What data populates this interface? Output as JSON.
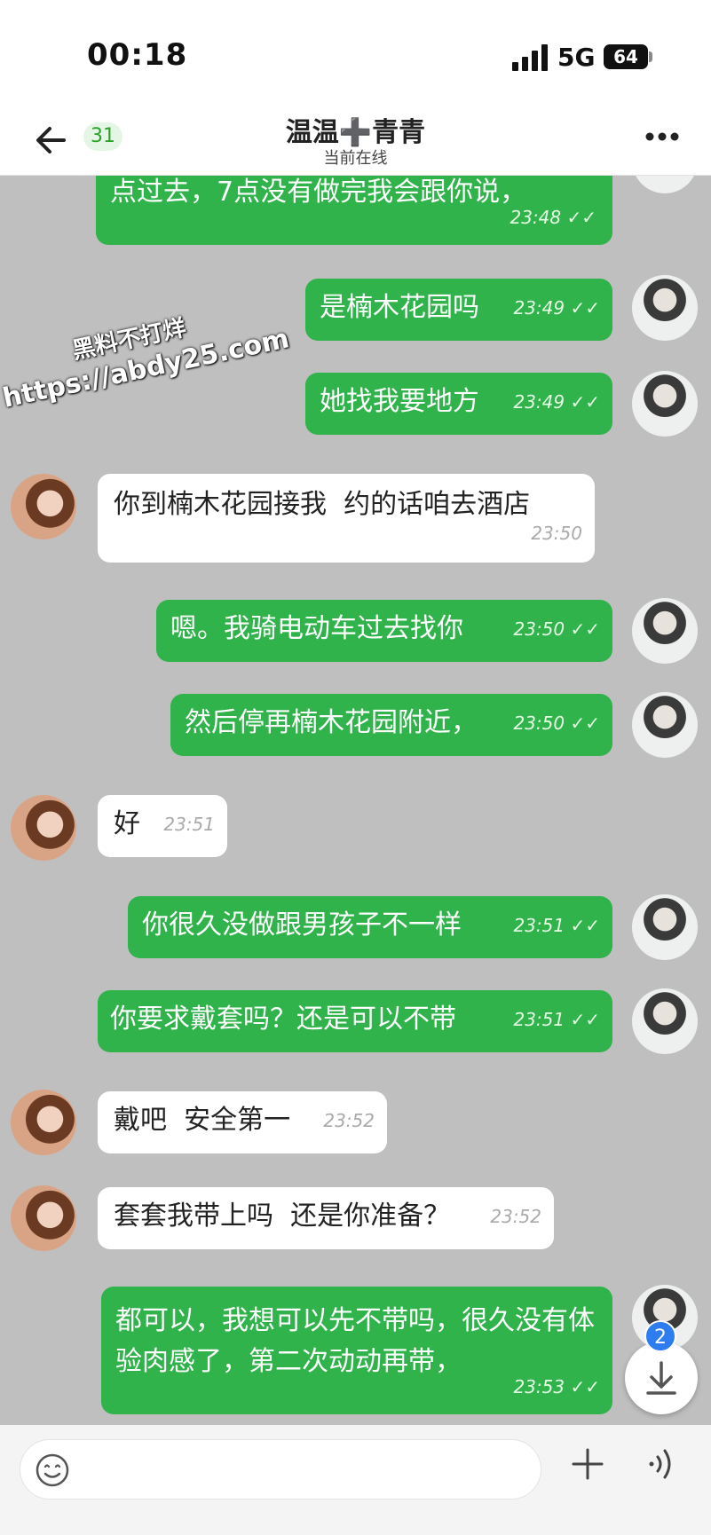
{
  "status": {
    "time": "00:18",
    "network": "5G",
    "battery": "64"
  },
  "header": {
    "unread": "31",
    "title": "温温➕青青",
    "subtitle": "当前在线",
    "icons": {
      "back": "arrow-left-icon",
      "more": "more-dots-icon"
    }
  },
  "watermark": {
    "line1": "黑料不打烊",
    "line2": "https://abdy25.com"
  },
  "messages": [
    {
      "dir": "out",
      "text": "点过去，7点没有做完我会跟你说，",
      "time": "23:48"
    },
    {
      "dir": "out",
      "text": "是楠木花园吗",
      "time": "23:49"
    },
    {
      "dir": "out",
      "text": "她找我要地方",
      "time": "23:49"
    },
    {
      "dir": "in",
      "text": "你到楠木花园接我  约的话咱去酒店",
      "time": "23:50"
    },
    {
      "dir": "out",
      "text": "嗯。我骑电动车过去找你",
      "time": "23:50"
    },
    {
      "dir": "out",
      "text": "然后停再楠木花园附近，",
      "time": "23:50"
    },
    {
      "dir": "in",
      "text": "好",
      "time": "23:51"
    },
    {
      "dir": "out",
      "text": "你很久没做跟男孩子不一样",
      "time": "23:51"
    },
    {
      "dir": "out",
      "text": "你要求戴套吗？还是可以不带",
      "time": "23:51"
    },
    {
      "dir": "in",
      "text": "戴吧  安全第一",
      "time": "23:52"
    },
    {
      "dir": "in",
      "text": "套套我带上吗  还是你准备？",
      "time": "23:52"
    },
    {
      "dir": "out",
      "text": "都可以，我想可以先不带吗，很久没有体验肉感了，第二次动动再带，",
      "time": "23:53"
    }
  ],
  "fab": {
    "count": "2",
    "icon": "scroll-down-icon"
  },
  "composer": {
    "placeholder": "",
    "icons": {
      "emoji": "emoji-icon",
      "plus": "plus-icon",
      "voice": "voice-icon"
    }
  }
}
